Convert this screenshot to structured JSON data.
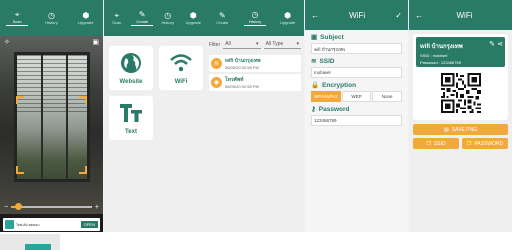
{
  "tabs": {
    "scan": "Scan",
    "history": "History",
    "create": "Create",
    "setting": "Setting",
    "upgrade": "Upgrade"
  },
  "create": {
    "items": [
      "Website",
      "WiFi",
      "Text"
    ]
  },
  "history": {
    "filter_label": "Filter",
    "filter_value": "All",
    "type_value": "All Type",
    "rows": [
      {
        "title": "wifi บ้านกรุงเทพ",
        "date": "06/05/20 02:58 PM"
      },
      {
        "title": "โทรศัพท์",
        "date": "06/05/20 02:55 PM"
      }
    ]
  },
  "wifi_form": {
    "title": "WiFi",
    "subject_label": "Subject",
    "subject_value": "wifi บ้านกรุงเทพ",
    "ssid_label": "SSID",
    "ssid_value": "mobiwel",
    "encryption_label": "Encryption",
    "enc_options": [
      "WPA/WPA2",
      "WEP",
      "None"
    ],
    "password_label": "Password",
    "password_value": "123456789"
  },
  "result": {
    "title": "WiFi",
    "name": "wifi บ้านกรุงเทพ",
    "ssid_line": "SSID : mobiwel",
    "password_line": "Password : 123456789",
    "date": "06/05/20 02:55 PM",
    "save_label": "SAVE PNG",
    "ssid_btn": "SSID",
    "password_btn": "PASSWORD"
  },
  "ad": {
    "text": "Test Ad ทดสอบ",
    "open": "OPEN"
  },
  "colors": {
    "brand": "#2a7a68",
    "accent": "#f2a93b"
  }
}
